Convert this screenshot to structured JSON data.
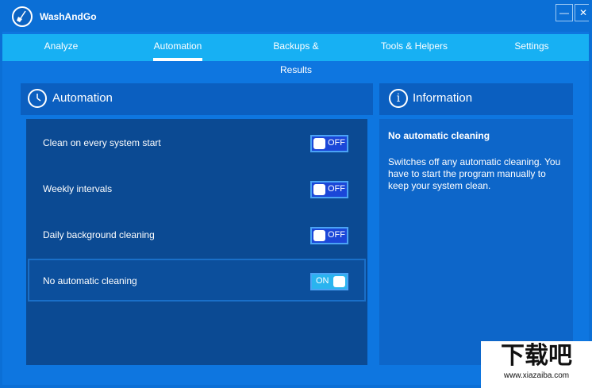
{
  "app": {
    "title": "WashAndGo"
  },
  "window_controls": {
    "minimize": "—",
    "close": "✕"
  },
  "tabs": [
    {
      "label": "Analyze"
    },
    {
      "label": "Automation"
    },
    {
      "label": "Backups & Results"
    },
    {
      "label": "Tools & Helpers"
    },
    {
      "label": "Settings"
    }
  ],
  "automation_panel": {
    "title": "Automation",
    "rows": [
      {
        "label": "Clean on every system start",
        "state": "OFF"
      },
      {
        "label": "Weekly intervals",
        "state": "OFF"
      },
      {
        "label": "Daily background cleaning",
        "state": "OFF"
      },
      {
        "label": "No automatic cleaning",
        "state": "ON"
      }
    ]
  },
  "info_panel": {
    "title": "Information",
    "heading": "No automatic cleaning",
    "text": "Switches off any automatic cleaning. You have to start the program manually to keep your system clean."
  },
  "watermark": {
    "big": "下载吧",
    "small": "www.xiazaiba.com"
  },
  "colors": {
    "titlebar": "#0B6FD6",
    "navbar": "#17B0F3",
    "panel_dark": "#0B4A93",
    "toggle_off": "#1B47D8",
    "toggle_on": "#2AB4EF"
  }
}
